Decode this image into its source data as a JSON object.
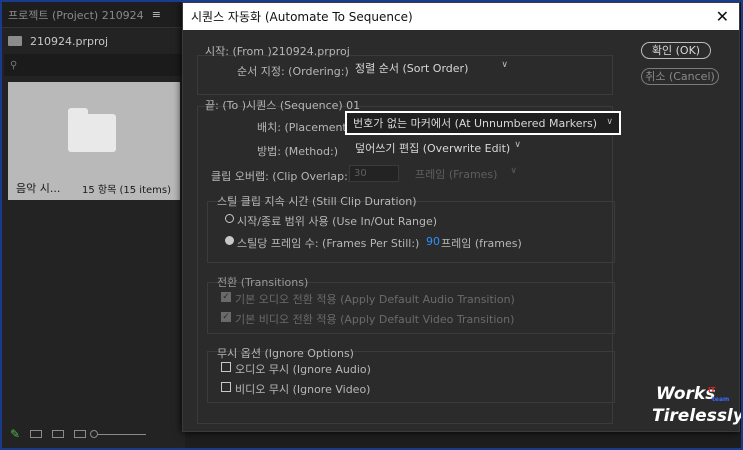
{
  "project_panel": {
    "tab_label": "프로젝트 (Project) 210924",
    "menu_icon": "hamburger-icon",
    "file_name": "210924.prproj",
    "bin_name": "음악 시...",
    "bin_count": "15 항목 (15 items)"
  },
  "dialog": {
    "title": "시퀀스 자동화 (Automate To Sequence)",
    "ok_label": "확인 (OK)",
    "cancel_label": "취소 (Cancel)",
    "from_label": "시작: (From )210924.prproj",
    "ordering_label": "순서 지정: (Ordering:)",
    "ordering_value": "정렬 순서 (Sort Order)",
    "to_label": "끝: (To )시퀀스 (Sequence) 01",
    "placement_label": "배치: (Placement:)",
    "placement_value": "번호가 없는 마커에서 (At Unnumbered Markers)",
    "method_label": "방법: (Method:)",
    "method_value": "덮어쓰기 편집 (Overwrite Edit)",
    "clip_overlap_label": "클립 오버랩: (Clip Overlap:)",
    "clip_overlap_value": "30",
    "clip_overlap_unit": "프레임 (Frames)",
    "still_section_label": "스틸 클립 지속 시간 (Still Clip Duration)",
    "use_in_out_label": "시작/종료 범위 사용 (Use In/Out Range)",
    "frames_per_still_label": "스틸당 프레임 수: (Frames Per Still:)",
    "frames_per_still_value": "90",
    "frames_unit": "프레임 (frames)",
    "transitions_section_label": "전환 (Transitions)",
    "apply_audio_transition_label": "기본 오디오 전환 적용 (Apply Default Audio Transition)",
    "apply_video_transition_label": "기본 비디오 전환 적용 (Apply Default Video Transition)",
    "ignore_section_label": "무시 옵션 (Ignore Options)",
    "ignore_audio_label": "오디오 무시 (Ignore Audio)",
    "ignore_video_label": "비디오 무시 (Ignore Video)"
  },
  "watermark": {
    "line1": "Works",
    "line2": "Tirelessly",
    "it": "IT",
    "team": "team"
  },
  "colors": {
    "accent_blue": "#2f8fff",
    "frame_blue": "#1a3a8c",
    "pencil_green": "#4cba4c"
  }
}
